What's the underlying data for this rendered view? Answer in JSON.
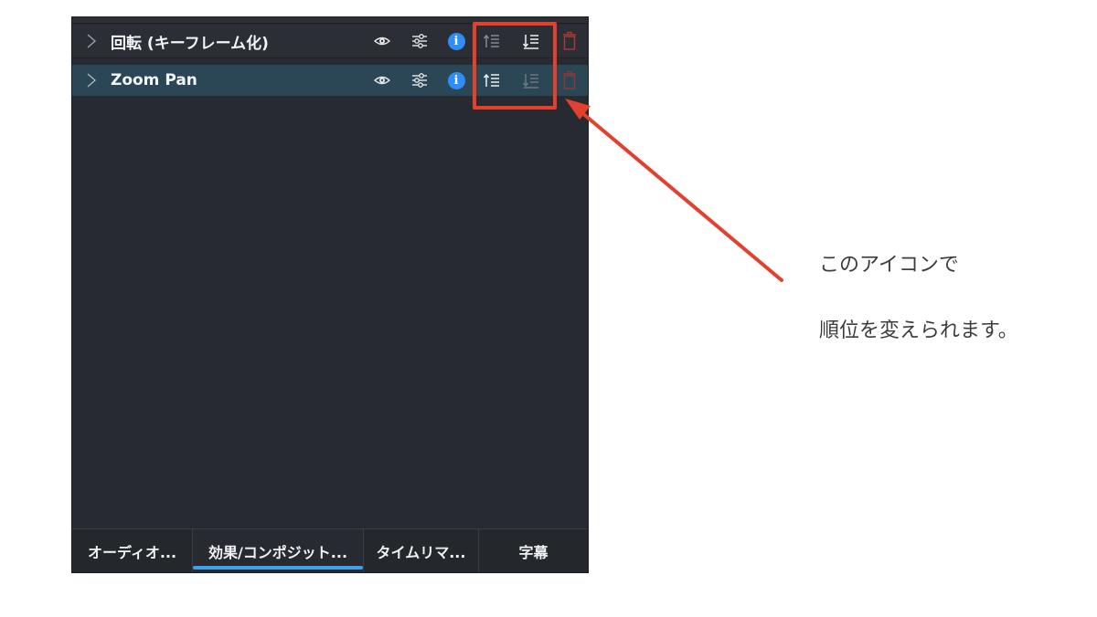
{
  "effects": [
    {
      "label": "回転 (キーフレーム化)",
      "icons": [
        "chevron-right-icon",
        "eye-icon",
        "adjust-sliders-icon",
        "info-icon",
        "move-up-icon",
        "move-down-icon",
        "trash-icon"
      ]
    },
    {
      "label": "Zoom Pan",
      "selected": true,
      "icons": [
        "chevron-right-icon",
        "eye-icon",
        "adjust-sliders-icon",
        "info-icon",
        "move-up-icon",
        "move-down-icon",
        "trash-icon"
      ]
    }
  ],
  "info_glyph": "i",
  "tabs": [
    {
      "label": "オーディオ..."
    },
    {
      "label": "効果/コンポジット...",
      "active": true
    },
    {
      "label": "タイムリマ..."
    },
    {
      "label": "字幕"
    }
  ],
  "annotation": {
    "line1": "このアイコンで",
    "line2": "順位を変えられます。",
    "color": "#e3402d"
  },
  "colors": {
    "panel_bg": "#272a30",
    "selected_row": "#2b4756",
    "info_blue": "#2f8ef5",
    "active_tab_underline": "#3ea2e6",
    "trash_red": "#b03a2e"
  }
}
